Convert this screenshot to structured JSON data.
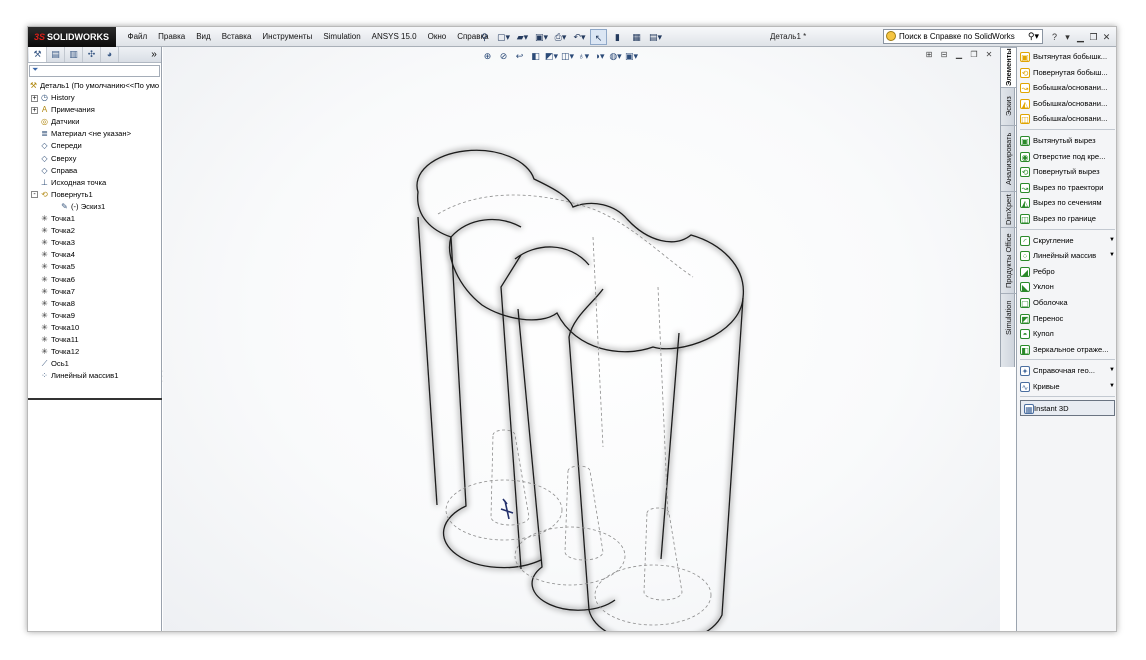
{
  "app": {
    "logo_prefix": "3S",
    "logo_text": "SOLIDWORKS",
    "document_title": "Деталь1 *"
  },
  "menu": [
    "Файл",
    "Правка",
    "Вид",
    "Вставка",
    "Инструменты",
    "Simulation",
    "ANSYS 15.0",
    "Окно",
    "Справка"
  ],
  "search": {
    "text": "Поиск в Справке по SolidWorks"
  },
  "feature_tree": {
    "root": "Деталь1  (По умолчанию<<По умо",
    "items": [
      {
        "label": "History",
        "icon": "history-icon",
        "expander": "+"
      },
      {
        "label": "Примечания",
        "icon": "annotations-icon",
        "expander": "+"
      },
      {
        "label": "Датчики",
        "icon": "sensor-icon",
        "expander": ""
      },
      {
        "label": "Материал <не указан>",
        "icon": "material-icon",
        "expander": ""
      },
      {
        "label": "Спереди",
        "icon": "plane-icon",
        "expander": ""
      },
      {
        "label": "Сверху",
        "icon": "plane-icon",
        "expander": ""
      },
      {
        "label": "Справа",
        "icon": "plane-icon",
        "expander": ""
      },
      {
        "label": "Исходная точка",
        "icon": "origin-icon",
        "expander": ""
      },
      {
        "label": "Повернуть1",
        "icon": "revolve-icon",
        "expander": "-"
      },
      {
        "label": "(-) Эскиз1",
        "icon": "sketch-icon",
        "expander": "",
        "indent": 1
      },
      {
        "label": "Точка1",
        "icon": "point-icon",
        "expander": ""
      },
      {
        "label": "Точка2",
        "icon": "point-icon",
        "expander": ""
      },
      {
        "label": "Точка3",
        "icon": "point-icon",
        "expander": ""
      },
      {
        "label": "Точка4",
        "icon": "point-icon",
        "expander": ""
      },
      {
        "label": "Точка5",
        "icon": "point-icon",
        "expander": ""
      },
      {
        "label": "Точка6",
        "icon": "point-icon",
        "expander": ""
      },
      {
        "label": "Точка7",
        "icon": "point-icon",
        "expander": ""
      },
      {
        "label": "Точка8",
        "icon": "point-icon",
        "expander": ""
      },
      {
        "label": "Точка9",
        "icon": "point-icon",
        "expander": ""
      },
      {
        "label": "Точка10",
        "icon": "point-icon",
        "expander": ""
      },
      {
        "label": "Точка11",
        "icon": "point-icon",
        "expander": ""
      },
      {
        "label": "Точка12",
        "icon": "point-icon",
        "expander": ""
      },
      {
        "label": "Ось1",
        "icon": "axis-icon",
        "expander": ""
      },
      {
        "label": "Линейный массив1",
        "icon": "linear-pattern-icon",
        "expander": ""
      }
    ]
  },
  "command_tabs": [
    "Элементы",
    "Эскиз",
    "Анализировать",
    "DimXpert",
    "Продукты Office",
    "Simulation"
  ],
  "command_manager": [
    {
      "label": "Вытянутая бобышк...",
      "icon": "extruded-boss-icon",
      "color": "#e0a400"
    },
    {
      "label": "Повернутая бобыш...",
      "icon": "revolved-boss-icon",
      "color": "#e0a400"
    },
    {
      "label": "Бобышка/основани...",
      "icon": "swept-boss-icon",
      "color": "#e0a400"
    },
    {
      "label": "Бобышка/основани...",
      "icon": "lofted-boss-icon",
      "color": "#e0a400"
    },
    {
      "label": "Бобышка/основани...",
      "icon": "boundary-boss-icon",
      "color": "#e0a400"
    },
    {
      "sep": true
    },
    {
      "label": "Вытянутый вырез",
      "icon": "extruded-cut-icon",
      "color": "#2a8a2a"
    },
    {
      "label": "Отверстие под кре...",
      "icon": "hole-wizard-icon",
      "color": "#2a8a2a"
    },
    {
      "label": "Повернутый вырез",
      "icon": "revolved-cut-icon",
      "color": "#2a8a2a"
    },
    {
      "label": "Вырез по траектори",
      "icon": "swept-cut-icon",
      "color": "#2a8a2a"
    },
    {
      "label": "Вырез по сечениям",
      "icon": "lofted-cut-icon",
      "color": "#2a8a2a"
    },
    {
      "label": "Вырез по границе",
      "icon": "boundary-cut-icon",
      "color": "#2a8a2a"
    },
    {
      "sep": true
    },
    {
      "label": "Скругление",
      "icon": "fillet-icon",
      "color": "#2a8a2a",
      "dropdown": true
    },
    {
      "label": "Линейный массив",
      "icon": "linear-pattern-icon",
      "color": "#2a8a2a",
      "dropdown": true
    },
    {
      "label": "Ребро",
      "icon": "rib-icon",
      "color": "#2a8a2a"
    },
    {
      "label": "Уклон",
      "icon": "draft-icon",
      "color": "#2a8a2a"
    },
    {
      "label": "Оболочка",
      "icon": "shell-icon",
      "color": "#2a8a2a"
    },
    {
      "label": "Перенос",
      "icon": "wrap-icon",
      "color": "#2a8a2a"
    },
    {
      "label": "Купол",
      "icon": "dome-icon",
      "color": "#2a8a2a"
    },
    {
      "label": "Зеркальное отраже...",
      "icon": "mirror-icon",
      "color": "#2a8a2a"
    },
    {
      "sep": true
    },
    {
      "label": "Справочная гео...",
      "icon": "reference-geometry-icon",
      "color": "#4a6ea0",
      "dropdown": true
    },
    {
      "label": "Кривые",
      "icon": "curves-icon",
      "color": "#4a6ea0",
      "dropdown": true
    },
    {
      "sep": true
    },
    {
      "label": "Instant 3D",
      "icon": "instant3d-icon",
      "color": "#4a6ea0",
      "highlight": true
    }
  ]
}
